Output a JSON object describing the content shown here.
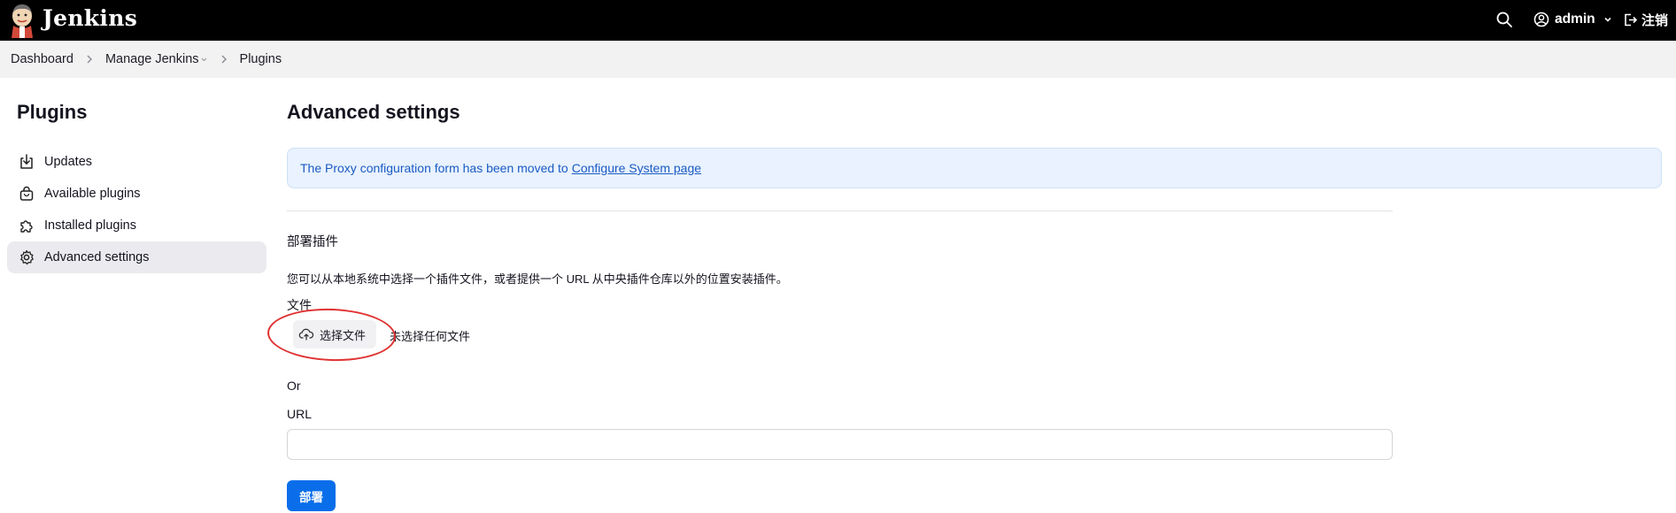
{
  "header": {
    "title": "Jenkins",
    "user": "admin",
    "logout_label": "注销",
    "icons": [
      "jenkins-logo-icon",
      "search-icon",
      "user-circle-icon",
      "chevron-down-icon",
      "logout-icon"
    ]
  },
  "breadcrumb": {
    "items": [
      {
        "label": "Dashboard"
      },
      {
        "label": "Manage Jenkins"
      },
      {
        "label": "Plugins"
      }
    ]
  },
  "sidebar": {
    "title": "Plugins",
    "items": [
      {
        "label": "Updates",
        "icon": "download-icon",
        "active": false
      },
      {
        "label": "Available plugins",
        "icon": "shopping-bag-icon",
        "active": false
      },
      {
        "label": "Installed plugins",
        "icon": "puzzle-icon",
        "active": false
      },
      {
        "label": "Advanced settings",
        "icon": "gear-icon",
        "active": true
      }
    ]
  },
  "main": {
    "title": "Advanced settings",
    "notice_text": "The Proxy configuration form has been moved to",
    "notice_link": "Configure System page",
    "deploy_section": {
      "title": "部署插件",
      "description": "您可以从本地系统中选择一个插件文件，或者提供一个 URL 从中央插件仓库以外的位置安装插件。",
      "file_label": "文件",
      "file_button": "选择文件",
      "file_status": "未选择任何文件",
      "or_label": "Or",
      "url_label": "URL",
      "url_value": "",
      "deploy_button": "部署"
    }
  },
  "colors": {
    "header_bg": "#000000",
    "breadcrumb_bg": "#f2f2f3",
    "notice_bg": "#e9f2fe",
    "notice_text": "#1a5bc4",
    "primary": "#0a6eea",
    "annotation": "#e03232"
  }
}
